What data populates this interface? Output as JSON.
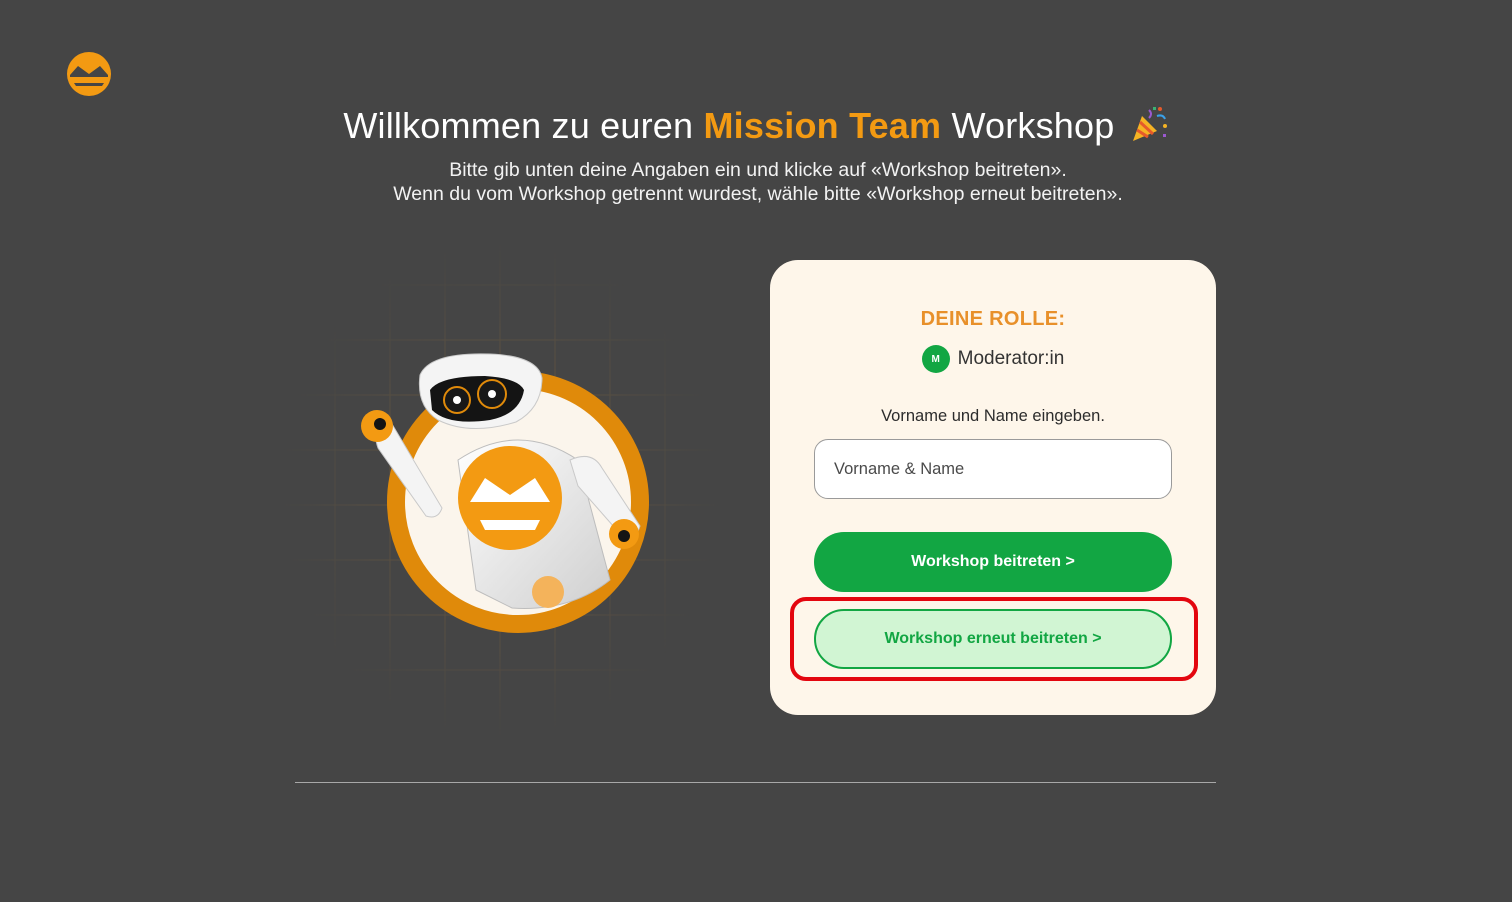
{
  "brand": {
    "logo_icon": "mission-team-logo-icon",
    "accent_color": "#F39A12"
  },
  "header": {
    "title_pre": "Willkommen zu euren",
    "title_accent": "Mission Team",
    "title_post": "Workshop",
    "title_emoji_icon": "party-popper-icon",
    "subtitle_line1": "Bitte gib unten deine Angaben ein und klicke auf «Workshop beitreten».",
    "subtitle_line2": "Wenn du vom Workshop getrennt wurdest, wähle bitte «Workshop erneut beitreten»."
  },
  "illustration": {
    "icon": "waving-robot-illustration"
  },
  "card": {
    "role_title": "DEINE ROLLE:",
    "role_badge": "M",
    "role_name": "Moderator:in",
    "name_label": "Vorname und Name eingeben.",
    "name_input": {
      "placeholder": "Vorname & Name",
      "value": ""
    },
    "join_button": "Workshop beitreten >",
    "rejoin_button": "Workshop erneut beitreten >"
  },
  "colors": {
    "background": "#454545",
    "card_bg": "#FEF6EA",
    "role_title": "#E8902A",
    "green": "#12A643",
    "green_light": "#D1F5D3",
    "highlight": "#E3060F"
  }
}
